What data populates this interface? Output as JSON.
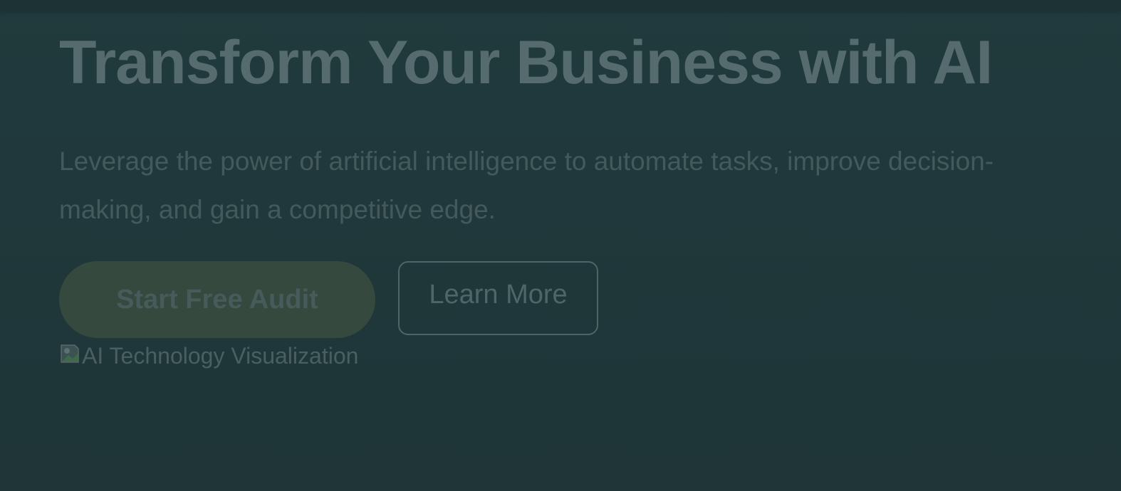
{
  "hero": {
    "title": "Transform Your Business with AI",
    "subtitle": "Leverage the power of artificial intelligence to automate tasks, improve decision-making, and gain a competitive edge."
  },
  "actions": {
    "primary_label": "Start Free Audit",
    "secondary_label": "Learn More"
  },
  "hero_image": {
    "alt": "AI Technology Visualization",
    "icon": "broken-image-icon"
  },
  "colors": {
    "background": "#1f3538",
    "title_text": "#566b6d",
    "body_text": "#44595b",
    "primary_button_bg": "#35493f",
    "secondary_button_border": "#4f6466"
  }
}
